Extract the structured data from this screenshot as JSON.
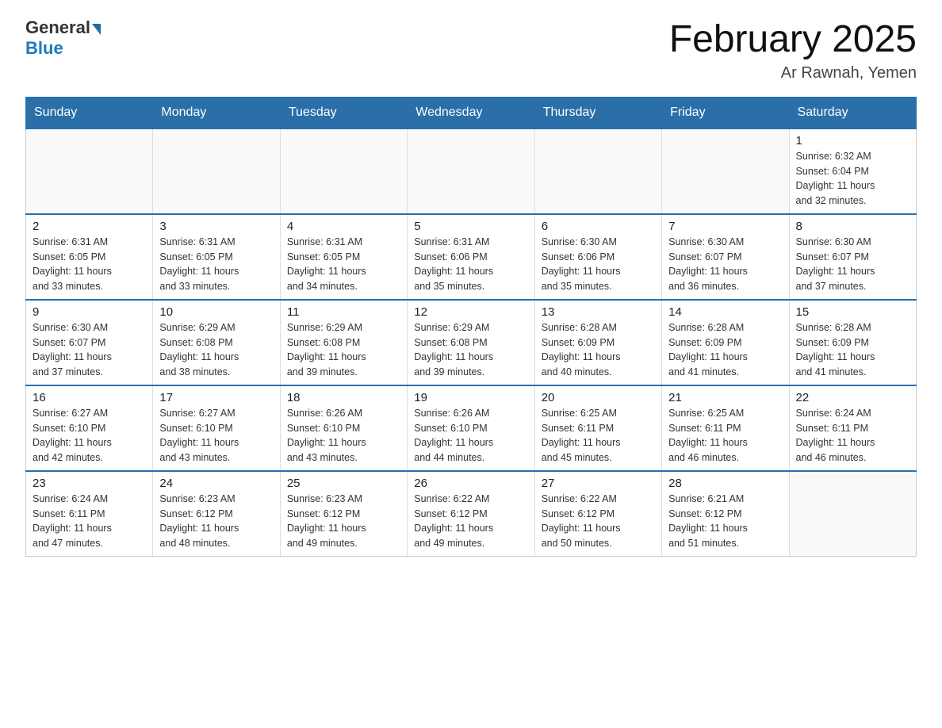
{
  "header": {
    "logo_general": "General",
    "logo_blue": "Blue",
    "month_title": "February 2025",
    "location": "Ar Rawnah, Yemen"
  },
  "days_of_week": [
    "Sunday",
    "Monday",
    "Tuesday",
    "Wednesday",
    "Thursday",
    "Friday",
    "Saturday"
  ],
  "weeks": [
    [
      {
        "day": "",
        "info": ""
      },
      {
        "day": "",
        "info": ""
      },
      {
        "day": "",
        "info": ""
      },
      {
        "day": "",
        "info": ""
      },
      {
        "day": "",
        "info": ""
      },
      {
        "day": "",
        "info": ""
      },
      {
        "day": "1",
        "info": "Sunrise: 6:32 AM\nSunset: 6:04 PM\nDaylight: 11 hours\nand 32 minutes."
      }
    ],
    [
      {
        "day": "2",
        "info": "Sunrise: 6:31 AM\nSunset: 6:05 PM\nDaylight: 11 hours\nand 33 minutes."
      },
      {
        "day": "3",
        "info": "Sunrise: 6:31 AM\nSunset: 6:05 PM\nDaylight: 11 hours\nand 33 minutes."
      },
      {
        "day": "4",
        "info": "Sunrise: 6:31 AM\nSunset: 6:05 PM\nDaylight: 11 hours\nand 34 minutes."
      },
      {
        "day": "5",
        "info": "Sunrise: 6:31 AM\nSunset: 6:06 PM\nDaylight: 11 hours\nand 35 minutes."
      },
      {
        "day": "6",
        "info": "Sunrise: 6:30 AM\nSunset: 6:06 PM\nDaylight: 11 hours\nand 35 minutes."
      },
      {
        "day": "7",
        "info": "Sunrise: 6:30 AM\nSunset: 6:07 PM\nDaylight: 11 hours\nand 36 minutes."
      },
      {
        "day": "8",
        "info": "Sunrise: 6:30 AM\nSunset: 6:07 PM\nDaylight: 11 hours\nand 37 minutes."
      }
    ],
    [
      {
        "day": "9",
        "info": "Sunrise: 6:30 AM\nSunset: 6:07 PM\nDaylight: 11 hours\nand 37 minutes."
      },
      {
        "day": "10",
        "info": "Sunrise: 6:29 AM\nSunset: 6:08 PM\nDaylight: 11 hours\nand 38 minutes."
      },
      {
        "day": "11",
        "info": "Sunrise: 6:29 AM\nSunset: 6:08 PM\nDaylight: 11 hours\nand 39 minutes."
      },
      {
        "day": "12",
        "info": "Sunrise: 6:29 AM\nSunset: 6:08 PM\nDaylight: 11 hours\nand 39 minutes."
      },
      {
        "day": "13",
        "info": "Sunrise: 6:28 AM\nSunset: 6:09 PM\nDaylight: 11 hours\nand 40 minutes."
      },
      {
        "day": "14",
        "info": "Sunrise: 6:28 AM\nSunset: 6:09 PM\nDaylight: 11 hours\nand 41 minutes."
      },
      {
        "day": "15",
        "info": "Sunrise: 6:28 AM\nSunset: 6:09 PM\nDaylight: 11 hours\nand 41 minutes."
      }
    ],
    [
      {
        "day": "16",
        "info": "Sunrise: 6:27 AM\nSunset: 6:10 PM\nDaylight: 11 hours\nand 42 minutes."
      },
      {
        "day": "17",
        "info": "Sunrise: 6:27 AM\nSunset: 6:10 PM\nDaylight: 11 hours\nand 43 minutes."
      },
      {
        "day": "18",
        "info": "Sunrise: 6:26 AM\nSunset: 6:10 PM\nDaylight: 11 hours\nand 43 minutes."
      },
      {
        "day": "19",
        "info": "Sunrise: 6:26 AM\nSunset: 6:10 PM\nDaylight: 11 hours\nand 44 minutes."
      },
      {
        "day": "20",
        "info": "Sunrise: 6:25 AM\nSunset: 6:11 PM\nDaylight: 11 hours\nand 45 minutes."
      },
      {
        "day": "21",
        "info": "Sunrise: 6:25 AM\nSunset: 6:11 PM\nDaylight: 11 hours\nand 46 minutes."
      },
      {
        "day": "22",
        "info": "Sunrise: 6:24 AM\nSunset: 6:11 PM\nDaylight: 11 hours\nand 46 minutes."
      }
    ],
    [
      {
        "day": "23",
        "info": "Sunrise: 6:24 AM\nSunset: 6:11 PM\nDaylight: 11 hours\nand 47 minutes."
      },
      {
        "day": "24",
        "info": "Sunrise: 6:23 AM\nSunset: 6:12 PM\nDaylight: 11 hours\nand 48 minutes."
      },
      {
        "day": "25",
        "info": "Sunrise: 6:23 AM\nSunset: 6:12 PM\nDaylight: 11 hours\nand 49 minutes."
      },
      {
        "day": "26",
        "info": "Sunrise: 6:22 AM\nSunset: 6:12 PM\nDaylight: 11 hours\nand 49 minutes."
      },
      {
        "day": "27",
        "info": "Sunrise: 6:22 AM\nSunset: 6:12 PM\nDaylight: 11 hours\nand 50 minutes."
      },
      {
        "day": "28",
        "info": "Sunrise: 6:21 AM\nSunset: 6:12 PM\nDaylight: 11 hours\nand 51 minutes."
      },
      {
        "day": "",
        "info": ""
      }
    ]
  ]
}
